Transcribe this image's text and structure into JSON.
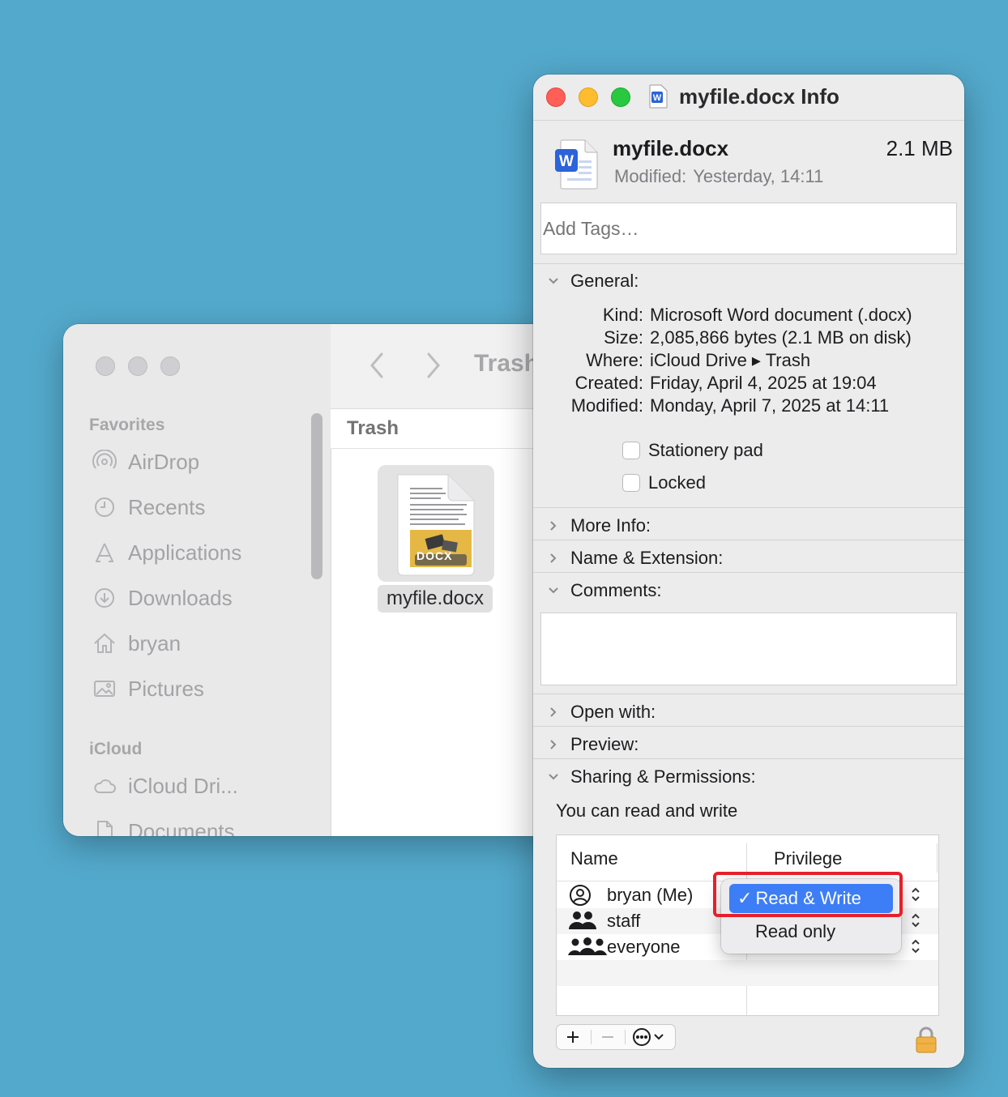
{
  "finder": {
    "path_title": "Trash",
    "column_header": "Trash",
    "sidebar": {
      "favorites_heading": "Favorites",
      "items": [
        {
          "label": "AirDrop",
          "icon": "airdrop-icon"
        },
        {
          "label": "Recents",
          "icon": "clock-icon"
        },
        {
          "label": "Applications",
          "icon": "applications-icon"
        },
        {
          "label": "Downloads",
          "icon": "download-icon"
        },
        {
          "label": "bryan",
          "icon": "home-icon"
        },
        {
          "label": "Pictures",
          "icon": "pictures-icon"
        }
      ],
      "icloud_heading": "iCloud",
      "icloud_items": [
        {
          "label": "iCloud Dri...",
          "icon": "cloud-icon"
        },
        {
          "label": "Documents",
          "icon": "document-icon"
        }
      ]
    },
    "file": {
      "name": "myfile.docx",
      "thumb_label": "DOCX"
    }
  },
  "info": {
    "window_title": "myfile.docx Info",
    "file_name": "myfile.docx",
    "file_size": "2.1 MB",
    "modified_label": "Modified:",
    "modified_value": "Yesterday, 14:11",
    "tags_placeholder": "Add Tags…",
    "general": {
      "heading": "General:",
      "rows": [
        {
          "key": "Kind:",
          "value": "Microsoft Word document (.docx)"
        },
        {
          "key": "Size:",
          "value": "2,085,866 bytes (2.1 MB on disk)"
        },
        {
          "key": "Where:",
          "value": "iCloud Drive ▸ Trash"
        },
        {
          "key": "Created:",
          "value": "Friday, April 4, 2025 at 19:04"
        },
        {
          "key": "Modified:",
          "value": "Monday, April 7, 2025 at 14:11"
        }
      ],
      "stationery_label": "Stationery pad",
      "locked_label": "Locked"
    },
    "sections": {
      "more_info": "More Info:",
      "name_extension": "Name & Extension:",
      "comments": "Comments:",
      "open_with": "Open with:",
      "preview": "Preview:",
      "sharing": "Sharing & Permissions:"
    },
    "permissions": {
      "summary": "You can read and write",
      "col_name": "Name",
      "col_privilege": "Privilege",
      "rows": [
        {
          "name": "bryan (Me)",
          "icon": "user-icon"
        },
        {
          "name": "staff",
          "icon": "group-icon"
        },
        {
          "name": "everyone",
          "icon": "everyone-icon"
        }
      ],
      "dropdown": {
        "selected": "Read & Write",
        "other": "Read only"
      }
    }
  },
  "colors": {
    "desktop": "#53a9cc",
    "accent": "#3d7ef7",
    "highlight": "#e5202a"
  }
}
